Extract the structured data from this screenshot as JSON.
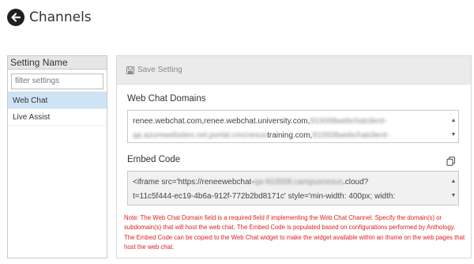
{
  "header": {
    "title": "Channels",
    "back_icon": "arrow-left-circle-icon"
  },
  "sidebar": {
    "column_header": "Setting Name",
    "filter_placeholder": "filter settings",
    "items": [
      {
        "label": "Web Chat",
        "active": true
      },
      {
        "label": "Live Assist",
        "active": false
      }
    ]
  },
  "toolbar": {
    "save_label": "Save Setting",
    "save_icon": "floppy-disk-icon"
  },
  "domains": {
    "label": "Web Chat Domains",
    "line1_visible": "renee.webchat.com,renee.webchat.university.com,",
    "line1_blurred": "910008webchatclient-",
    "line2_blurred": "qa.azurewebsites.net,portal.cmcnexus",
    "line2_visible": "training.com,",
    "line2_blurred_tail": "910008webchatclient-"
  },
  "embed": {
    "label": "Embed Code",
    "copy_icon": "copy-icon",
    "line1_visible": "<iframe src='https://reneewebchat-",
    "line1_blurred": "qa-910008.campusnexus",
    "line1_tail": ".cloud?",
    "line2_visible": "t=11c5f444-ec19-4b6a-912f-772b2bd8171c' style='min-width: 400px; width:"
  },
  "note": "Note: The Web Chat Domain field is a required field if implementing the Web Chat Channel. Specify the domain(s) or subdomain(s) that will host the web chat. The Embed Code is populated based on configurations performed by Anthology. The Embed Code can be copied to the Web Chat widget to make the widget available within an iframe on the web pages that host the web chat.",
  "colors": {
    "active_item": "#cfe3f6",
    "note_text": "#e02020",
    "toolbar_bg": "#ebebeb"
  }
}
